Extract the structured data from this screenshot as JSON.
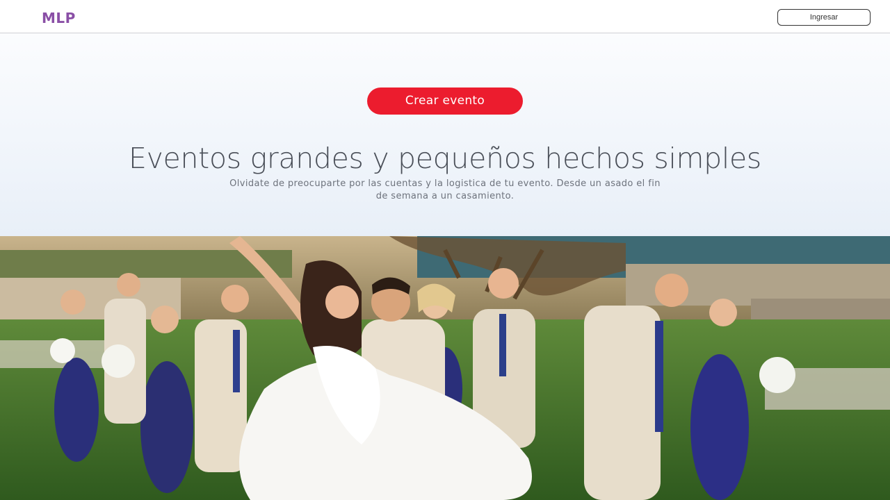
{
  "header": {
    "logo": "MLP",
    "login_label": "Ingresar"
  },
  "hero": {
    "cta_label": "Crear evento",
    "headline": "Eventos grandes y pequeños hechos simples",
    "subheadline": "Olvidate de preocuparte por las cuentas y la logistica de tu evento. Desde un asado el fin de semana a un casamiento."
  },
  "colors": {
    "brand": "#8a4fa6",
    "cta": "#ec1c2e"
  }
}
